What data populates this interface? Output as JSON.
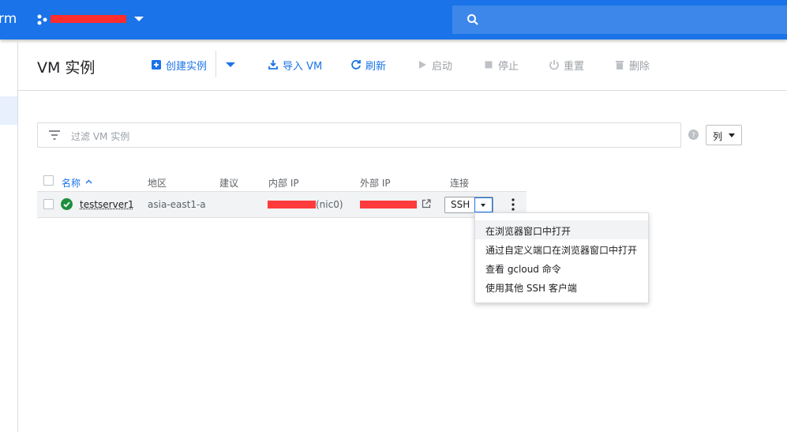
{
  "topbar": {
    "brand_fragment": "rm",
    "colors": {
      "topbar": "#1a73e8",
      "search": "#3d87ea"
    },
    "icons": [
      "project-icon",
      "chevron-down-icon",
      "search-icon"
    ]
  },
  "toolbar": {
    "title": "VM 实例",
    "create_label": "创建实例",
    "import_label": "导入 VM",
    "refresh_label": "刷新",
    "start_label": "启动",
    "stop_label": "停止",
    "reset_label": "重置",
    "delete_label": "删除"
  },
  "filter": {
    "placeholder": "过滤 VM 实例",
    "columns_label": "列"
  },
  "table": {
    "headers": {
      "name": "名称",
      "zone": "地区",
      "recommendation": "建议",
      "internal_ip": "内部 IP",
      "external_ip": "外部 IP",
      "connect": "连接"
    },
    "rows": [
      {
        "status": "running",
        "name": "testserver1",
        "zone": "asia-east1-a",
        "recommendation": "",
        "internal_ip_suffix": "(nic0)",
        "connect_label": "SSH"
      }
    ]
  },
  "ssh_menu": {
    "items": [
      "在浏览器窗口中打开",
      "通过自定义端口在浏览器窗口中打开",
      "查看 gcloud 命令",
      "使用其他 SSH 客户端"
    ]
  },
  "colors": {
    "accent": "#1a73e8",
    "success": "#1e8e3e",
    "disabled": "#9aa0a6",
    "redaction": "#ff3b3b"
  }
}
